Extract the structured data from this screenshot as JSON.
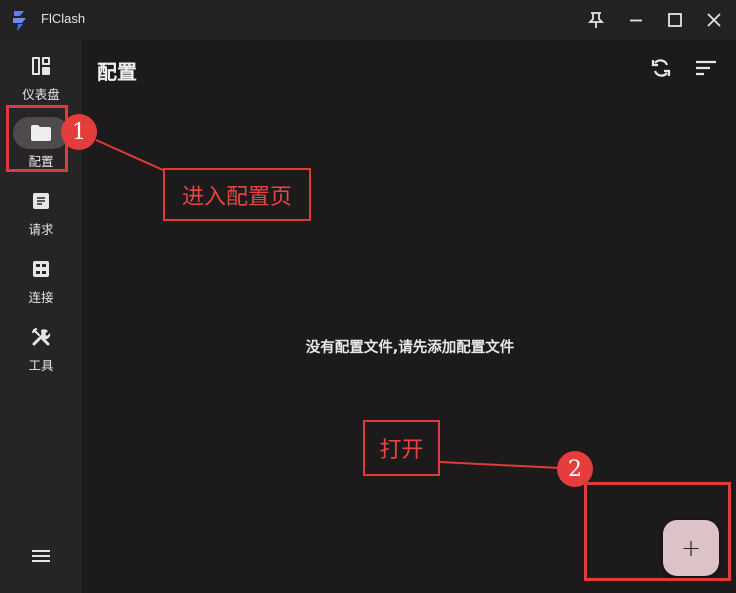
{
  "window": {
    "title": "FlClash"
  },
  "sidebar": {
    "items": [
      {
        "label": "仪表盘",
        "icon": "dashboard-icon",
        "active": false
      },
      {
        "label": "配置",
        "icon": "folder-icon",
        "active": true
      },
      {
        "label": "请求",
        "icon": "request-icon",
        "active": false
      },
      {
        "label": "连接",
        "icon": "connection-icon",
        "active": false
      },
      {
        "label": "工具",
        "icon": "tools-icon",
        "active": false
      }
    ]
  },
  "main": {
    "title": "配置",
    "empty_message": "没有配置文件,请先添加配置文件",
    "fab_label": "+"
  },
  "annotations": {
    "step1": {
      "number": "1",
      "text": "进入配置页"
    },
    "step2": {
      "number": "2",
      "text": "打开"
    }
  },
  "colors": {
    "accent": "#e03b3a",
    "fab": "#dcc3c8",
    "active_nav": "#4f4a4c"
  }
}
